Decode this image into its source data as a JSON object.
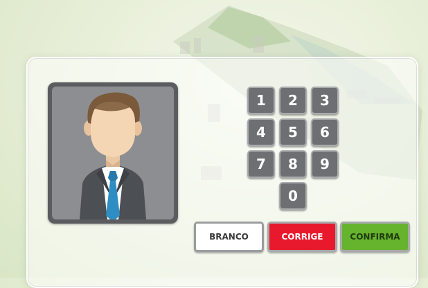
{
  "keypad": {
    "keys": [
      "1",
      "2",
      "3",
      "4",
      "5",
      "6",
      "7",
      "8",
      "9",
      "0"
    ]
  },
  "buttons": {
    "branco": "BRANCO",
    "corrige": "CORRIGE",
    "confirma": "CONFIRMA"
  },
  "colors": {
    "corrige": "#e8192c",
    "confirma": "#66b32e",
    "branco": "#ffffff",
    "key": "#6e6f73"
  },
  "icons": {
    "candidate": "candidate-avatar-icon"
  }
}
